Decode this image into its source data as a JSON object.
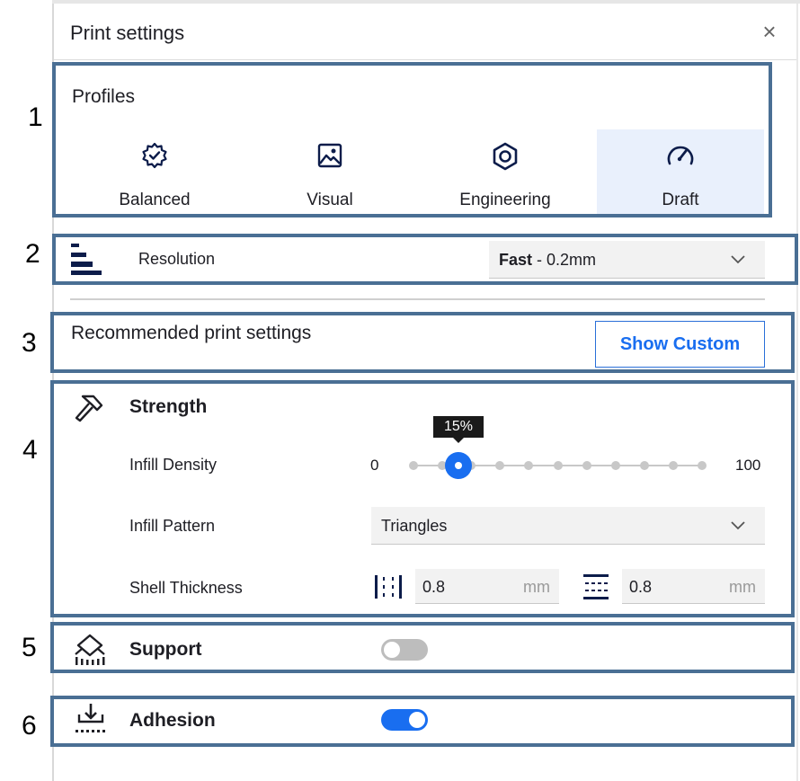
{
  "dialog": {
    "title": "Print settings",
    "close_glyph": "×"
  },
  "callout_numbers": [
    "1",
    "2",
    "3",
    "4",
    "5",
    "6"
  ],
  "profiles": {
    "label": "Profiles",
    "items": [
      {
        "label": "Balanced",
        "icon": "badge-check-icon",
        "selected": false
      },
      {
        "label": "Visual",
        "icon": "image-icon",
        "selected": false
      },
      {
        "label": "Engineering",
        "icon": "hex-nut-icon",
        "selected": false
      },
      {
        "label": "Draft",
        "icon": "speedometer-icon",
        "selected": true
      }
    ]
  },
  "resolution": {
    "label": "Resolution",
    "icon": "layer-height-icon",
    "value_bold": "Fast",
    "value_rest": " - 0.2mm"
  },
  "recommended": {
    "label": "Recommended print settings",
    "button": "Show Custom"
  },
  "strength": {
    "title": "Strength",
    "icon": "hammer-icon",
    "infill_density": {
      "label": "Infill Density",
      "min_label": "0",
      "max_label": "100",
      "value_label": "15%",
      "value": 15,
      "steps": 11
    },
    "infill_pattern": {
      "label": "Infill Pattern",
      "value": "Triangles"
    },
    "shell_thickness": {
      "label": "Shell Thickness",
      "wall": {
        "value": "0.8",
        "unit": "mm",
        "icon": "wall-thickness-icon"
      },
      "top_bottom": {
        "value": "0.8",
        "unit": "mm",
        "icon": "top-bottom-thickness-icon"
      }
    }
  },
  "support": {
    "title": "Support",
    "icon": "support-icon",
    "enabled": false
  },
  "adhesion": {
    "title": "Adhesion",
    "icon": "adhesion-icon",
    "enabled": true
  },
  "colors": {
    "accent": "#196ef0",
    "callout_border": "#4a6f94",
    "selected_bg": "#e9f0fc",
    "icon": "#0c1c4a"
  }
}
